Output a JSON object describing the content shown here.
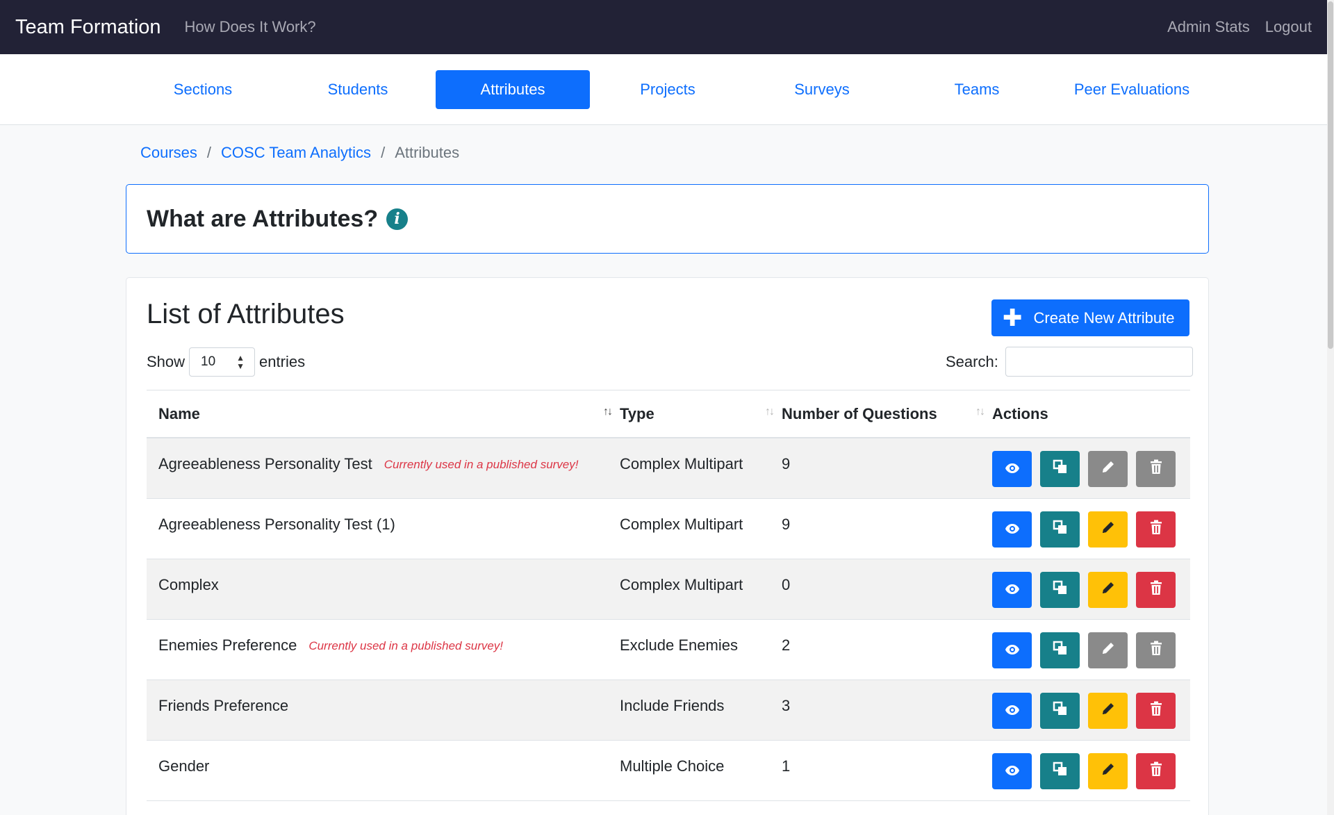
{
  "navbar": {
    "brand": "Team Formation",
    "how_link": "How Does It Work?",
    "admin_stats": "Admin Stats",
    "logout": "Logout"
  },
  "tabs": [
    {
      "label": "Sections",
      "active": false
    },
    {
      "label": "Students",
      "active": false
    },
    {
      "label": "Attributes",
      "active": true
    },
    {
      "label": "Projects",
      "active": false
    },
    {
      "label": "Surveys",
      "active": false
    },
    {
      "label": "Teams",
      "active": false
    },
    {
      "label": "Peer Evaluations",
      "active": false
    }
  ],
  "breadcrumb": {
    "courses": "Courses",
    "course": "COSC Team Analytics",
    "current": "Attributes",
    "separator": "/"
  },
  "info": {
    "title": "What are Attributes?",
    "icon_glyph": "i"
  },
  "list": {
    "title": "List of Attributes",
    "create_label": "Create New Attribute",
    "show_label": "Show",
    "entries_value": "10",
    "entries_label": "entries",
    "search_label": "Search:",
    "search_value": ""
  },
  "table": {
    "headers": {
      "name": "Name",
      "type": "Type",
      "num_questions": "Number of Questions",
      "actions": "Actions"
    },
    "rows": [
      {
        "name": "Agreeableness Personality Test",
        "warning": "Currently used in a published survey!",
        "type": "Complex Multipart",
        "questions": "9",
        "locked": true
      },
      {
        "name": "Agreeableness Personality Test (1)",
        "warning": "",
        "type": "Complex Multipart",
        "questions": "9",
        "locked": false
      },
      {
        "name": "Complex",
        "warning": "",
        "type": "Complex Multipart",
        "questions": "0",
        "locked": false
      },
      {
        "name": "Enemies Preference",
        "warning": "Currently used in a published survey!",
        "type": "Exclude Enemies",
        "questions": "2",
        "locked": true
      },
      {
        "name": "Friends Preference",
        "warning": "",
        "type": "Include Friends",
        "questions": "3",
        "locked": false
      },
      {
        "name": "Gender",
        "warning": "",
        "type": "Multiple Choice",
        "questions": "1",
        "locked": false
      }
    ]
  },
  "colors": {
    "primary": "#0d6efd",
    "teal": "#17808a",
    "warning": "#ffc107",
    "danger": "#dc3545",
    "disabled": "#8a8a8a",
    "navbar": "#222236"
  }
}
